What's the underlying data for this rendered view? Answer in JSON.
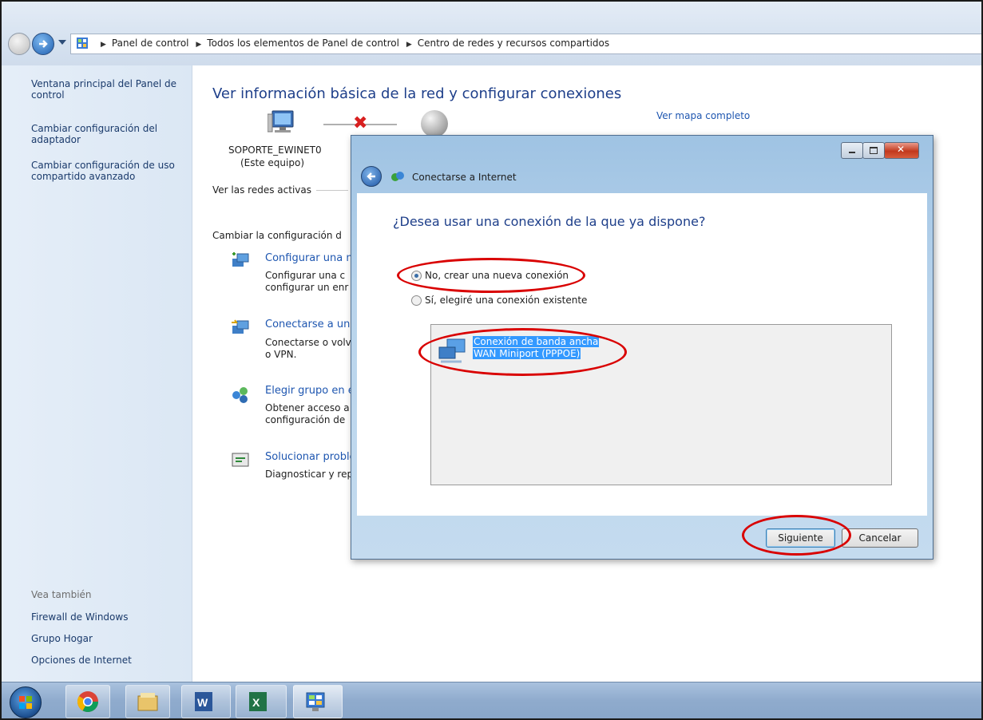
{
  "address_bar": {
    "breadcrumbs": [
      "Panel de control",
      "Todos los elementos de Panel de control",
      "Centro de redes y recursos compartidos"
    ]
  },
  "left_pane": {
    "links": [
      "Ventana principal del Panel de control",
      "Cambiar configuración del adaptador",
      "Cambiar configuración de uso compartido avanzado"
    ],
    "see_also_title": "Vea también",
    "see_also": [
      "Firewall de Windows",
      "Grupo Hogar",
      "Opciones de Internet"
    ]
  },
  "main": {
    "title": "Ver información básica de la red y configurar conexiones",
    "computer_name": "SOPORTE_EWINET0",
    "computer_caption": "(Este equipo)",
    "full_map_link": "Ver mapa completo",
    "active_networks": "Ver las redes activas",
    "change_config": "Cambiar la configuración d",
    "tasks": [
      {
        "link": "Configurar una n",
        "desc1": "Configurar una c",
        "desc2": "configurar un enr"
      },
      {
        "link": "Conectarse a una",
        "desc1": "Conectarse o volv",
        "desc2": "o VPN."
      },
      {
        "link": "Elegir grupo en el",
        "desc1": "Obtener acceso a",
        "desc2": "configuración de"
      },
      {
        "link": "Solucionar proble",
        "desc1": "Diagnosticar y rep",
        "desc2": ""
      }
    ]
  },
  "dialog": {
    "title": "Conectarse a Internet",
    "question": "¿Desea usar una conexión de la que ya dispone?",
    "option_new": "No, crear una nueva conexión",
    "option_existing": "Sí, elegiré una conexión existente",
    "selected_option": "new",
    "connection_line1": "Conexión de banda ancha",
    "connection_line2": "WAN Miniport (PPPOE)",
    "next_button": "Siguiente",
    "cancel_button": "Cancelar"
  },
  "taskbar": {
    "items": [
      "start-orb",
      "chrome-icon",
      "file-explorer-icon",
      "word-icon",
      "excel-icon",
      "control-panel-icon"
    ]
  },
  "colors": {
    "link_blue": "#1e56b0",
    "heading_blue": "#1e3f8a",
    "annotation_red": "#d90000",
    "selection_blue": "#3399ff"
  }
}
